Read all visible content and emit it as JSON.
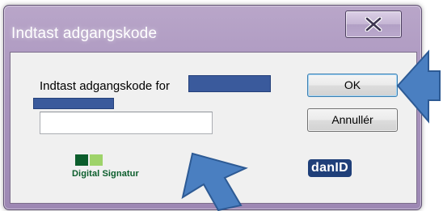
{
  "window": {
    "title": "Indtast adgangskode",
    "frame_color": "#a893bd"
  },
  "titlebar": {
    "close_icon": "close-icon"
  },
  "dialog": {
    "prompt_label": "Indtast adgangskode for",
    "password_value": "",
    "ok_label": "OK",
    "cancel_label": "Annullér"
  },
  "logos": {
    "digital_signatur": "Digital Signatur",
    "danid": "danID"
  },
  "annotations": {
    "arrow_color": "#4a7fc1",
    "redaction_color": "#3a5a9c"
  }
}
